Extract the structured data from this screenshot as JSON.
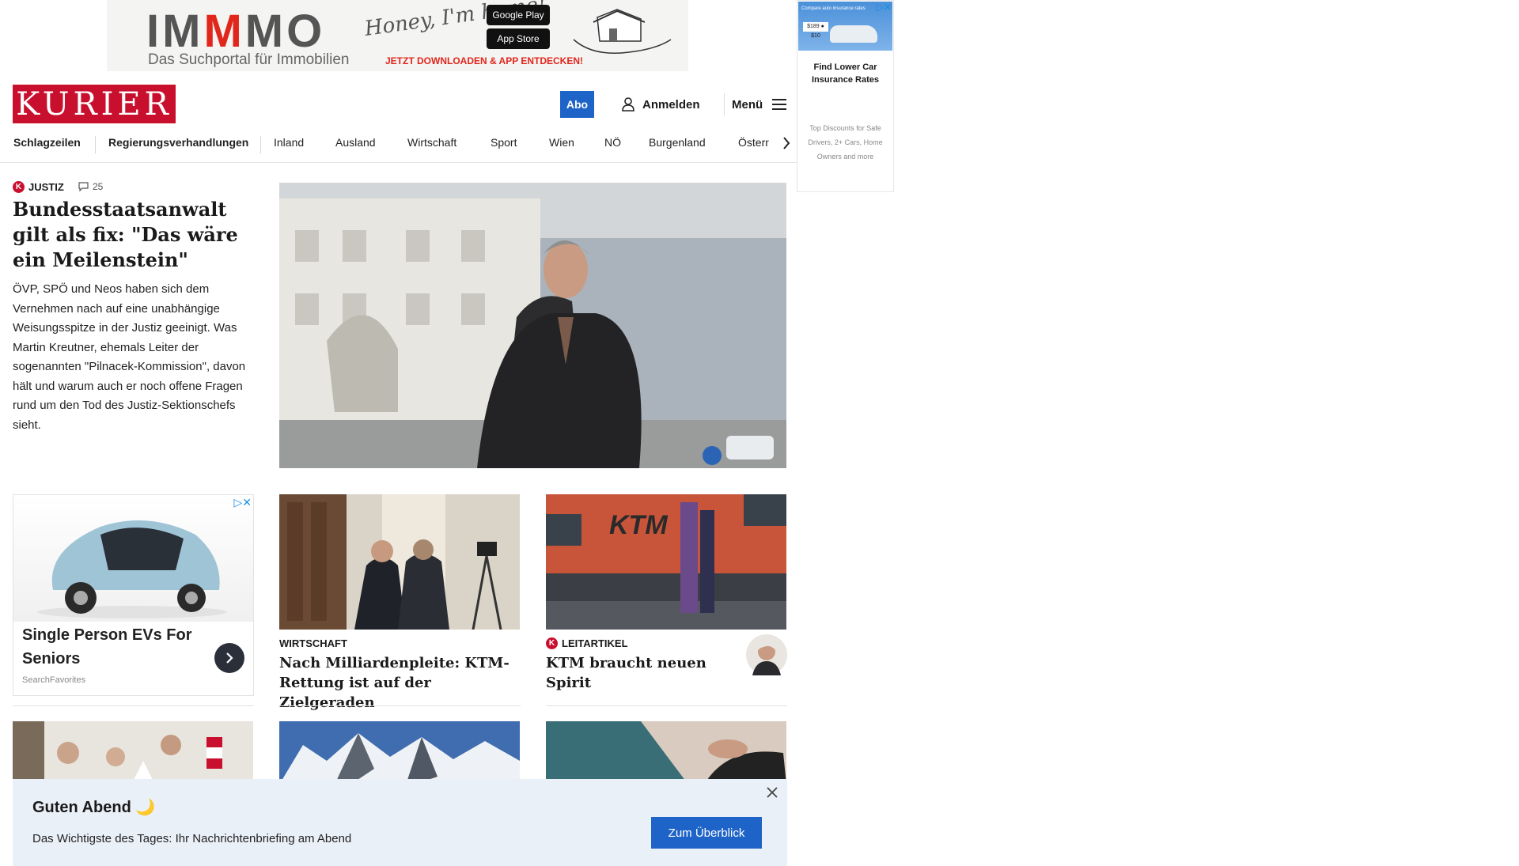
{
  "top_ad": {
    "brand_left": "IM",
    "brand_m": "M",
    "brand_right": "MO",
    "tagline": "Das Suchportal für Immobilien",
    "script": "Honey, I'm home!",
    "google_play": "Google Play",
    "app_store": "App Store",
    "cta": "JETZT DOWNLOADEN & APP ENTDECKEN!"
  },
  "side_ad": {
    "image_text": "Compare auto insurance rates",
    "price_tag": "$189 ● $10",
    "title": "Find Lower Car Insurance Rates",
    "text": "Top Discounts for Safe Drivers, 2+ Cars, Home Owners and more"
  },
  "header": {
    "logo": "KURIER",
    "abo": "Abo",
    "login": "Anmelden",
    "menu": "Menü"
  },
  "nav": {
    "items": [
      "Schlagzeilen",
      "Regierungsverhandlungen",
      "Inland",
      "Ausland",
      "Wirtschaft",
      "Sport",
      "Wien",
      "NÖ",
      "Burgenland",
      "Österr"
    ]
  },
  "lead": {
    "badge": "K",
    "kicker": "JUSTIZ",
    "comments": "25",
    "title": "Bundesstaatsanwalt gilt als fix: \"Das wäre ein Meilenstein\"",
    "text": "ÖVP, SPÖ und Neos haben sich dem Vernehmen nach auf eine unabhängige Weisungsspitze in der Justiz geeinigt. Was Martin Kreutner, ehemals Leiter der sogenannten \"Pilnacek-Kommission\", davon hält und warum auch er noch offene Fragen rund um den Tod des Justiz-Sektionschefs sieht."
  },
  "inline_ad": {
    "title": "Single Person EVs For Seniors",
    "source": "SearchFavorites"
  },
  "cards": [
    {
      "kicker": "WIRTSCHAFT",
      "title": "Nach Milliardenpleite: KTM-Rettung ist auf der Zielgeraden"
    },
    {
      "badge": "K",
      "kicker": "LEITARTIKEL",
      "title": "KTM braucht neuen Spirit",
      "sign": "KTM"
    }
  ],
  "toast": {
    "title": "Guten Abend 🌙",
    "text": "Das Wichtigste des Tages: Ihr Nachrichtenbriefing am Abend",
    "button": "Zum Überblick"
  },
  "colors": {
    "brand_red": "#c8102e",
    "accent_blue": "#1e64c8",
    "toast_bg": "#eaf0f8"
  }
}
